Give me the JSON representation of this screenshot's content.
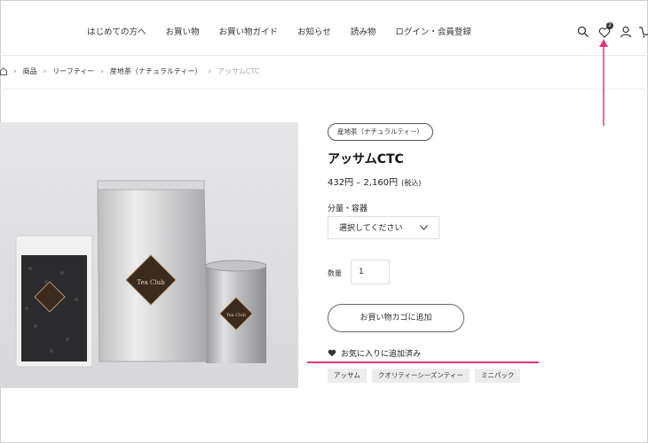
{
  "header": {
    "nav": [
      "はじめての方へ",
      "お買い物",
      "お買い物ガイド",
      "お知らせ",
      "読み物",
      "ログイン・会員登録"
    ],
    "favorites_count": "2",
    "icons": [
      "search-icon",
      "heart-icon",
      "user-icon",
      "cart-icon"
    ]
  },
  "breadcrumb": {
    "items": [
      "商品",
      "リーフティー",
      "産地茶（ナチュラルティー）"
    ],
    "current": "アッサムCTC"
  },
  "product": {
    "category": "産地茶（ナチュラルティー）",
    "title": "アッサムCTC",
    "price": "432円 – 2,160円",
    "tax_note": "(税込)",
    "option_label": "分量・容器",
    "select_value": "選択してください",
    "qty_label": "数量",
    "qty_value": "1",
    "cart_button": "お買い物カゴに追加",
    "favorite_status": "お気に入りに追加済み",
    "tags": [
      "アッサム",
      "クオリティーシーズンティー",
      "ミニパック"
    ]
  },
  "annotation": {
    "color": "#e2377f"
  }
}
